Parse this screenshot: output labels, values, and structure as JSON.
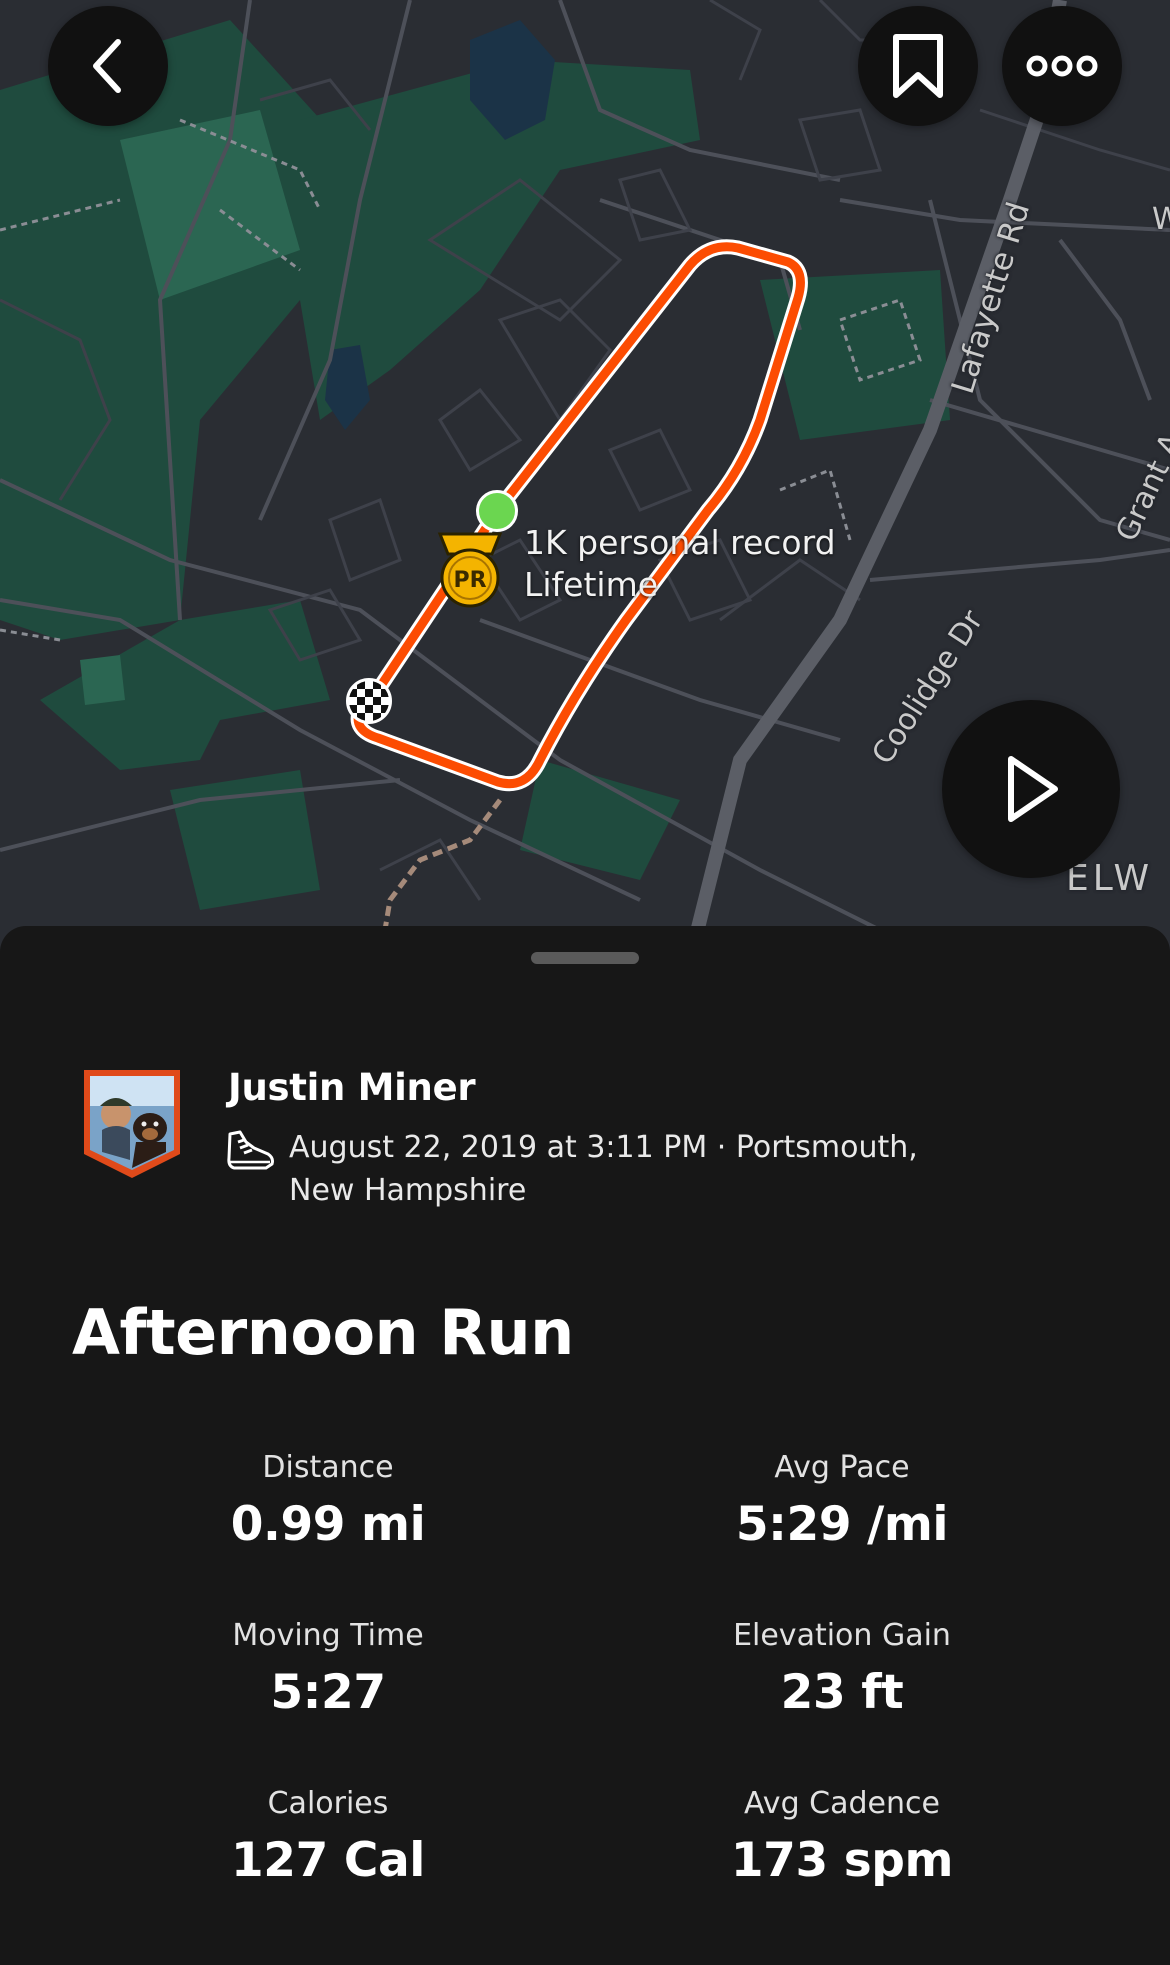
{
  "map": {
    "road_labels": {
      "lafayette": "Lafayette Rd",
      "coolidge": "Coolidge Dr",
      "grant": "Grant A",
      "elw": "ELW",
      "w": "W"
    },
    "pr_marker": {
      "badge": "PR",
      "line1": "1K personal record",
      "line2": "Lifetime"
    },
    "route_color": "#FC4C02",
    "start_color": "#6BD650"
  },
  "icons": {
    "back": "chevron-left-icon",
    "save": "bookmark-icon",
    "more": "more-dots-icon",
    "play": "play-icon",
    "sport": "running-shoe-icon"
  },
  "athlete": {
    "name": "Justin Miner"
  },
  "activity": {
    "meta": "August 22, 2019 at 3:11 PM · Portsmouth, New Hampshire",
    "title": "Afternoon Run"
  },
  "stats": [
    {
      "label": "Distance",
      "value": "0.99 mi"
    },
    {
      "label": "Avg Pace",
      "value": "5:29 /mi"
    },
    {
      "label": "Moving Time",
      "value": "5:27"
    },
    {
      "label": "Elevation Gain",
      "value": "23 ft"
    },
    {
      "label": "Calories",
      "value": "127 Cal"
    },
    {
      "label": "Avg Cadence",
      "value": "173 spm"
    }
  ]
}
